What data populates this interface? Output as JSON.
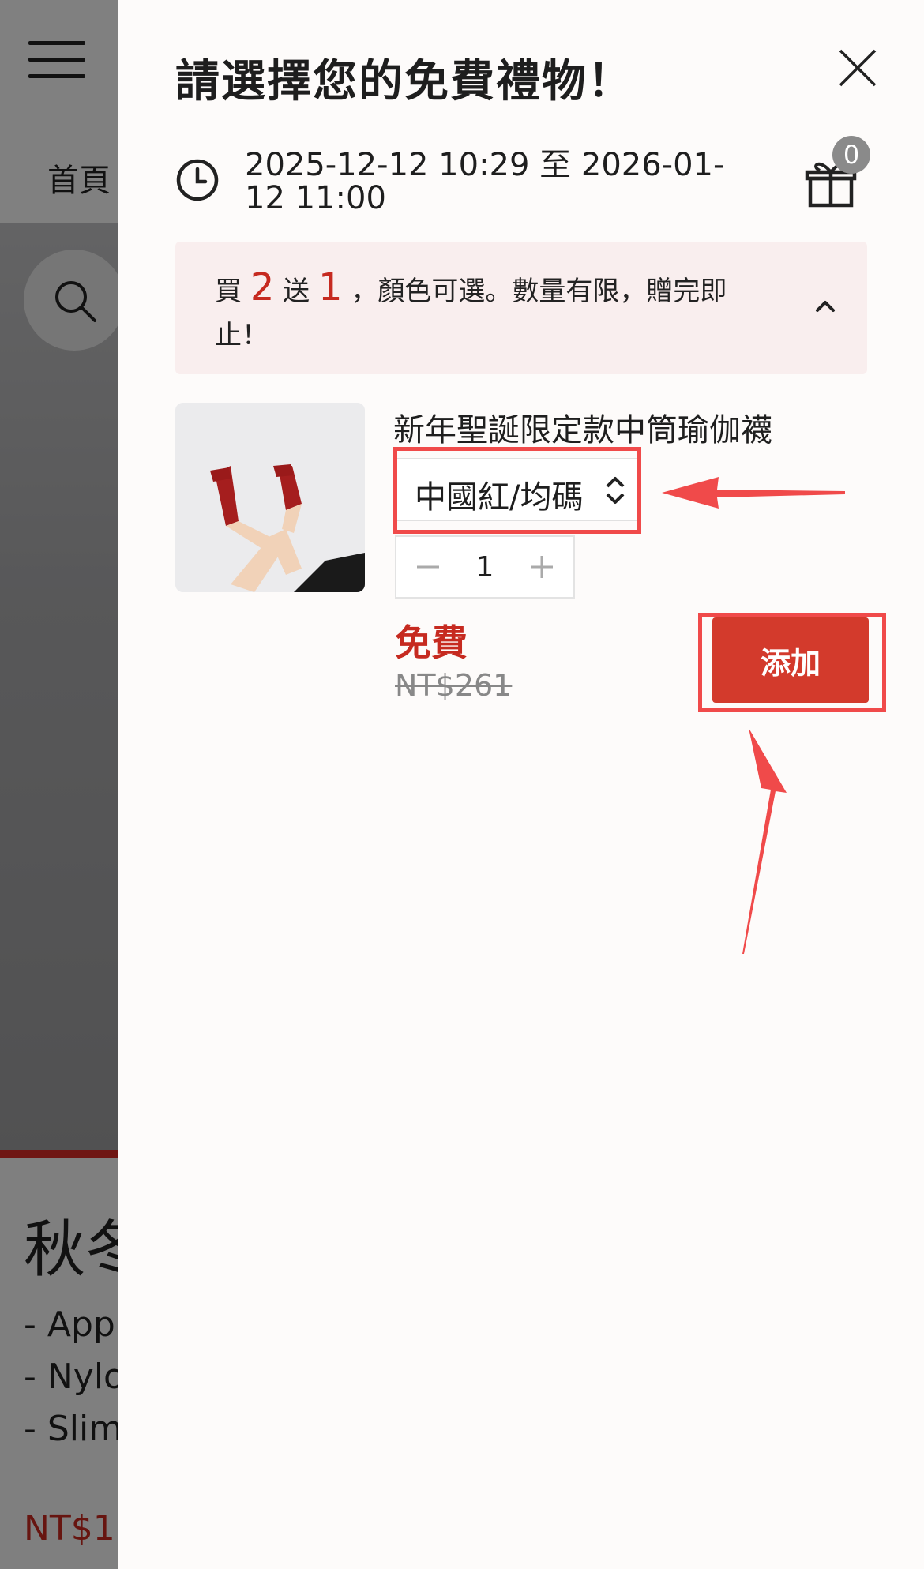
{
  "background": {
    "nav_home": "首頁",
    "product_title": "秋冬",
    "lines": [
      "- Appli",
      "- Nylor",
      "- Slimr"
    ],
    "price": "NT$1"
  },
  "drawer": {
    "title": "請選擇您的免費禮物！",
    "date_range": "2025-12-12 10:29 至 2026-01-12 11:00",
    "gift_count": "0",
    "promo": {
      "prefix": "買",
      "buy_qty": "2",
      "mid": "送",
      "free_qty": "1",
      "suffix": "，顏色可選。數量有限，贈完即止！"
    },
    "product": {
      "name": "新年聖誕限定款中筒瑜伽襪",
      "variant": "中國紅/均碼",
      "quantity": "1",
      "free_label": "免費",
      "original_price": "NT$261",
      "add_button": "添加"
    }
  },
  "icons": {
    "menu": "hamburger-icon",
    "search": "search-icon",
    "close": "close-icon",
    "clock": "clock-icon",
    "gift": "gift-icon",
    "chevron": "chevron-up-icon",
    "select": "select-arrows-icon",
    "minus": "minus-icon",
    "plus": "plus-icon"
  },
  "colors": {
    "accent_red": "#d33a2c",
    "price_red": "#c62a20",
    "promo_bg": "#f9eeee",
    "annotation_red": "#f04a4a"
  }
}
